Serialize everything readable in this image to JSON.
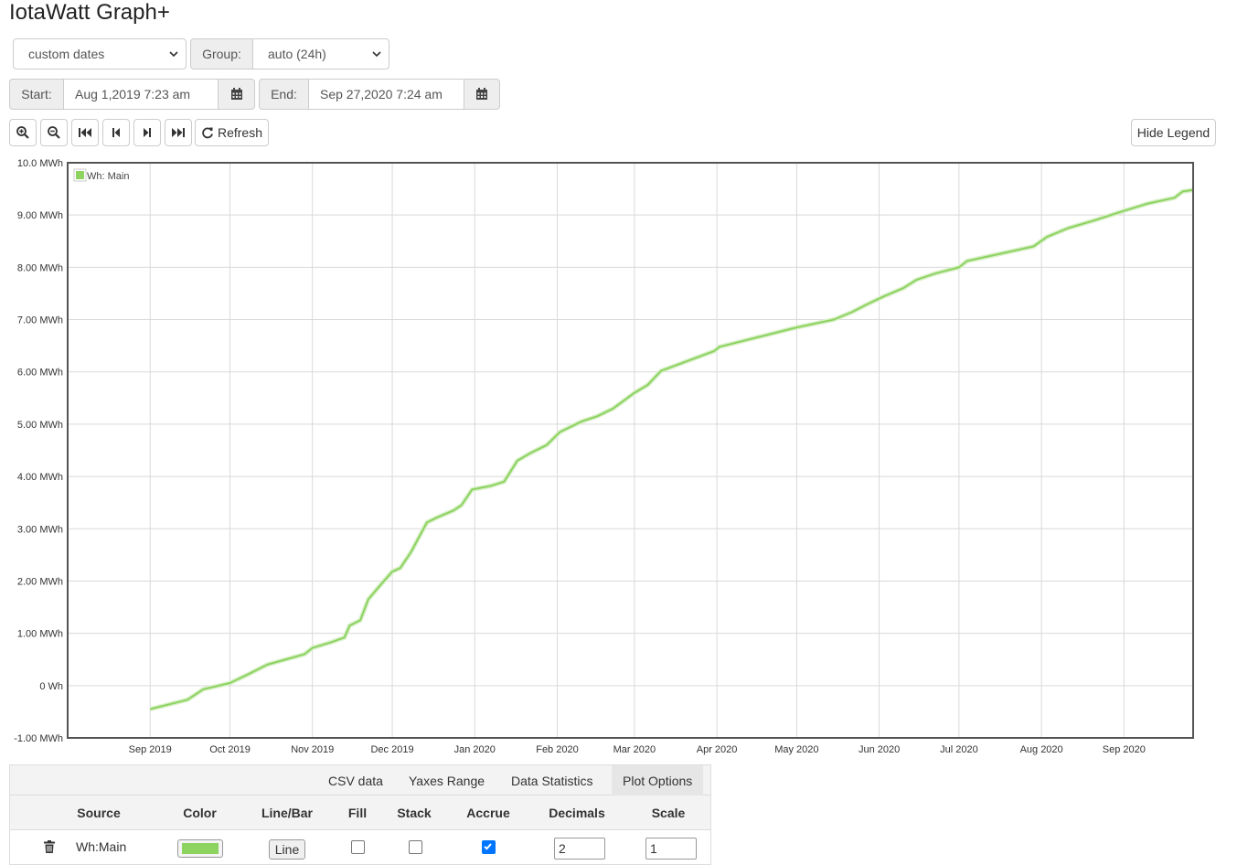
{
  "app": {
    "title": "IotaWatt Graph+"
  },
  "controls": {
    "period_select": "custom dates",
    "group_label": "Group:",
    "group_select": "auto (24h)",
    "start_label": "Start:",
    "start_value": "Aug 1,2019 7:23 am",
    "end_label": "End:",
    "end_value": "Sep 27,2020 7:24 am",
    "refresh_label": "Refresh",
    "hide_legend_label": "Hide Legend"
  },
  "icons": [
    "zoom-in-icon",
    "zoom-out-icon",
    "skip-to-start-icon",
    "step-back-icon",
    "step-forward-icon",
    "skip-to-end-icon",
    "refresh-icon",
    "calendar-icon",
    "trash-icon"
  ],
  "colors": {
    "series": "#8cd35f",
    "chart_border": "#545454",
    "grid": "#d9d9d9"
  },
  "chart_data": {
    "type": "line",
    "legend_position": "top-left",
    "grid": true,
    "x_ticks": [
      "Sep 2019",
      "Oct 2019",
      "Nov 2019",
      "Dec 2019",
      "Jan 2020",
      "Feb 2020",
      "Mar 2020",
      "Apr 2020",
      "May 2020",
      "Jun 2020",
      "Jul 2020",
      "Aug 2020",
      "Sep 2020"
    ],
    "y_ticks": [
      "-1.00 MWh",
      "0 Wh",
      "1.00 MWh",
      "2.00 MWh",
      "3.00 MWh",
      "4.00 MWh",
      "5.00 MWh",
      "6.00 MWh",
      "7.00 MWh",
      "8.00 MWh",
      "9.00 MWh",
      "10.0 MWh"
    ],
    "xlim": [
      "2019-08-01",
      "2020-09-27"
    ],
    "ylim": [
      -1.0,
      10.0
    ],
    "series": [
      {
        "name": "Wh: Main",
        "color": "#8cd35f",
        "points": [
          [
            "2019-09-01",
            -0.45
          ],
          [
            "2019-09-15",
            -0.27
          ],
          [
            "2019-09-21",
            -0.07
          ],
          [
            "2019-10-01",
            0.05
          ],
          [
            "2019-10-08",
            0.22
          ],
          [
            "2019-10-15",
            0.4
          ],
          [
            "2019-10-29",
            0.6
          ],
          [
            "2019-11-01",
            0.72
          ],
          [
            "2019-11-08",
            0.83
          ],
          [
            "2019-11-13",
            0.92
          ],
          [
            "2019-11-15",
            1.15
          ],
          [
            "2019-11-19",
            1.25
          ],
          [
            "2019-11-22",
            1.65
          ],
          [
            "2019-11-27",
            1.95
          ],
          [
            "2019-12-01",
            2.18
          ],
          [
            "2019-12-04",
            2.25
          ],
          [
            "2019-12-08",
            2.55
          ],
          [
            "2019-12-14",
            3.12
          ],
          [
            "2019-12-18",
            3.22
          ],
          [
            "2019-12-24",
            3.35
          ],
          [
            "2019-12-27",
            3.45
          ],
          [
            "2019-12-31",
            3.75
          ],
          [
            "2020-01-07",
            3.82
          ],
          [
            "2020-01-12",
            3.9
          ],
          [
            "2020-01-17",
            4.3
          ],
          [
            "2020-01-22",
            4.45
          ],
          [
            "2020-01-28",
            4.6
          ],
          [
            "2020-02-02",
            4.85
          ],
          [
            "2020-02-10",
            5.05
          ],
          [
            "2020-02-16",
            5.15
          ],
          [
            "2020-02-22",
            5.3
          ],
          [
            "2020-03-01",
            5.6
          ],
          [
            "2020-03-06",
            5.75
          ],
          [
            "2020-03-11",
            6.02
          ],
          [
            "2020-03-31",
            6.4
          ],
          [
            "2020-04-02",
            6.48
          ],
          [
            "2020-05-01",
            6.85
          ],
          [
            "2020-05-15",
            7.0
          ],
          [
            "2020-05-22",
            7.15
          ],
          [
            "2020-05-27",
            7.28
          ],
          [
            "2020-06-03",
            7.45
          ],
          [
            "2020-06-10",
            7.6
          ],
          [
            "2020-06-15",
            7.76
          ],
          [
            "2020-06-22",
            7.88
          ],
          [
            "2020-07-01",
            8.0
          ],
          [
            "2020-07-04",
            8.12
          ],
          [
            "2020-07-29",
            8.4
          ],
          [
            "2020-08-03",
            8.58
          ],
          [
            "2020-08-11",
            8.75
          ],
          [
            "2020-08-21",
            8.9
          ],
          [
            "2020-09-01",
            9.08
          ],
          [
            "2020-09-10",
            9.22
          ],
          [
            "2020-09-20",
            9.33
          ],
          [
            "2020-09-23",
            9.45
          ],
          [
            "2020-09-27",
            9.48
          ]
        ]
      }
    ]
  },
  "panel": {
    "tabs": [
      "CSV data",
      "Yaxes Range",
      "Data Statistics",
      "Plot Options"
    ],
    "active_tab": "Plot Options",
    "columns": [
      "Source",
      "Color",
      "Line/Bar",
      "Fill",
      "Stack",
      "Accrue",
      "Decimals",
      "Scale"
    ],
    "rows": [
      {
        "source": "Wh:Main",
        "color": "#8cd35f",
        "line_bar": "Line",
        "fill": false,
        "stack": false,
        "accrue": true,
        "decimals": "2",
        "scale": "1"
      }
    ]
  }
}
